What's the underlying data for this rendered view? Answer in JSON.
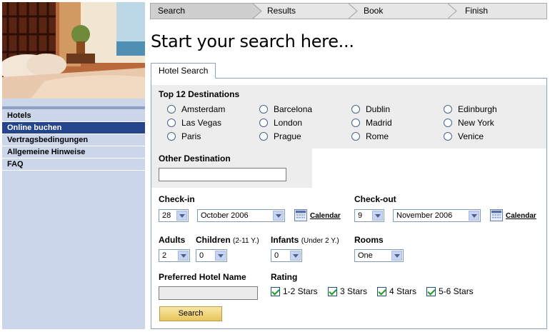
{
  "sidebar": {
    "items": [
      {
        "label": "Hotels"
      },
      {
        "label": "Online buchen"
      },
      {
        "label": "Vertragsbedingungen"
      },
      {
        "label": "Allgemeine Hinweise"
      },
      {
        "label": "FAQ"
      }
    ]
  },
  "steps": [
    "Search",
    "Results",
    "Book",
    "Finish"
  ],
  "heading": "Start your search here...",
  "tab": "Hotel Search",
  "destinations": {
    "title": "Top 12 Destinations",
    "items": [
      "Amsterdam",
      "Barcelona",
      "Dublin",
      "Edinburgh",
      "Las Vegas",
      "London",
      "Madrid",
      "New York",
      "Paris",
      "Prague",
      "Rome",
      "Venice"
    ]
  },
  "other": {
    "label": "Other Destination",
    "value": ""
  },
  "checkin": {
    "label": "Check-in",
    "day": "28",
    "month": "October 2006",
    "calendar": "Calendar"
  },
  "checkout": {
    "label": "Check-out",
    "day": "9",
    "month": "November 2006",
    "calendar": "Calendar"
  },
  "guests": {
    "adults_label": "Adults",
    "adults": "2",
    "children_label": "Children",
    "children_note": "(2-11 Y.)",
    "children": "0",
    "infants_label": "Infants",
    "infants_note": "(Under 2 Y.)",
    "infants": "0",
    "rooms_label": "Rooms",
    "rooms": "One"
  },
  "hotel_name": {
    "label": "Preferred Hotel Name",
    "value": ""
  },
  "rating": {
    "label": "Rating",
    "options": [
      "1-2 Stars",
      "3 Stars",
      "4 Stars",
      "5-6 Stars"
    ]
  },
  "search_button": "Search"
}
